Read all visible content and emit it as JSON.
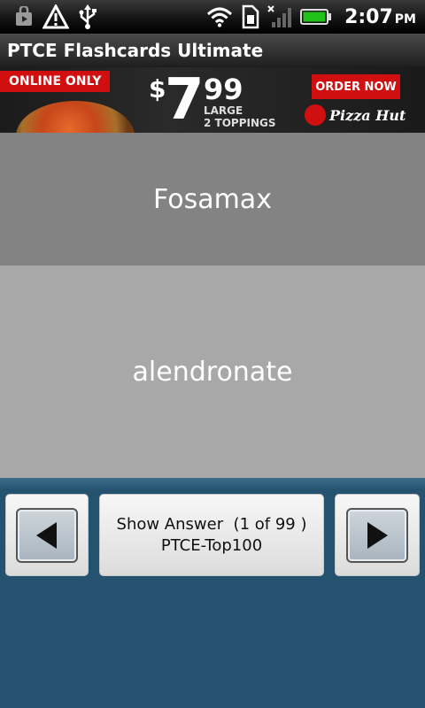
{
  "status_bar": {
    "time": "2:07",
    "ampm": "PM",
    "icons": [
      "bag-icon",
      "warning-icon",
      "usb-icon",
      "wifi-icon",
      "sim-icon",
      "no-signal-icon",
      "battery-icon"
    ]
  },
  "app": {
    "title": "PTCE Flashcards Ultimate"
  },
  "ad": {
    "badge": "ONLINE ONLY",
    "dollar": "$",
    "price_whole": "7",
    "price_cents": "99",
    "line1": "LARGE",
    "line2": "2 TOPPINGS",
    "order_button": "ORDER NOW",
    "brand": "Pizza Hut"
  },
  "card": {
    "question": "Fosamax",
    "answer": "alendronate"
  },
  "controls": {
    "show_answer_line1": "Show Answer  (1 of 99 )",
    "show_answer_line2": "PTCE-Top100"
  },
  "colors": {
    "question_bg": "#838383",
    "answer_bg": "#a8a8a8",
    "bottom_bg": "#25526e"
  }
}
